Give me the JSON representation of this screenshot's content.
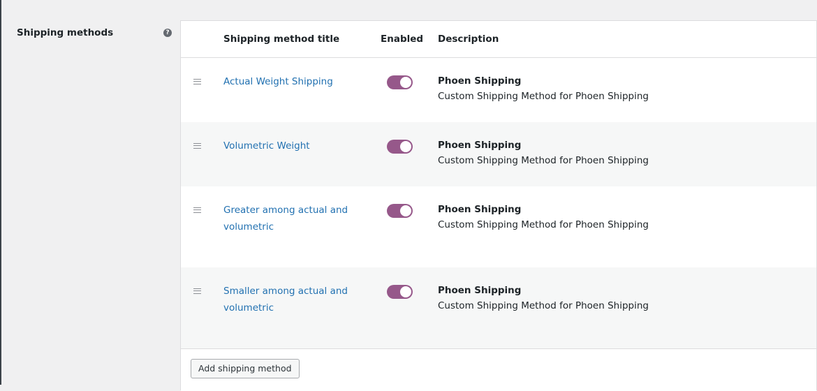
{
  "field": {
    "label": "Shipping methods",
    "help_icon": "question-circle-icon",
    "help_glyph": "?"
  },
  "table": {
    "headers": {
      "title": "Shipping method title",
      "enabled": "Enabled",
      "description": "Description"
    },
    "rows": [
      {
        "title_line1": "Actual Weight Shipping",
        "title_line2": "",
        "enabled": true,
        "desc_title": "Phoen Shipping",
        "desc_text": "Custom Shipping Method for Phoen Shipping"
      },
      {
        "title_line1": "Volumetric Weight",
        "title_line2": "",
        "enabled": true,
        "desc_title": "Phoen Shipping",
        "desc_text": "Custom Shipping Method for Phoen Shipping"
      },
      {
        "title_line1": "Greater among actual and",
        "title_line2": "volumetric",
        "enabled": true,
        "desc_title": "Phoen Shipping",
        "desc_text": "Custom Shipping Method for Phoen Shipping"
      },
      {
        "title_line1": "Smaller among actual and",
        "title_line2": "volumetric",
        "enabled": true,
        "desc_title": "Phoen Shipping",
        "desc_text": "Custom Shipping Method for Phoen Shipping"
      }
    ]
  },
  "footer": {
    "add_button_label": "Add shipping method"
  },
  "colors": {
    "link": "#2271b1",
    "toggle_on": "#96588a",
    "alt_row": "#f6f7f7"
  }
}
